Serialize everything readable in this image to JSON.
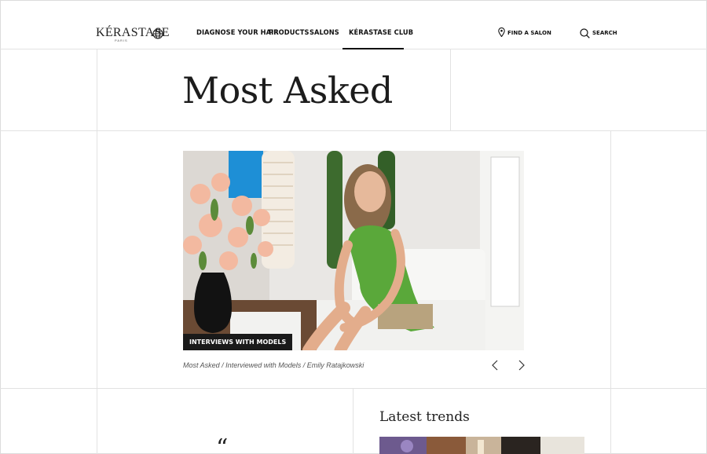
{
  "brand": {
    "logo": "KÉRASTASE",
    "logo_sub": "PARIS"
  },
  "nav": {
    "items": [
      {
        "label": "DIAGNOSE YOUR HAIR"
      },
      {
        "label": "PRODUCTS"
      },
      {
        "label": "SALONS"
      },
      {
        "label": "KÉRASTASE CLUB"
      }
    ],
    "find_salon": "FIND A SALON",
    "search": "SEARCH"
  },
  "page": {
    "title": "Most Asked"
  },
  "hero": {
    "tag": "INTERVIEWS WITH MODELS",
    "caption": "Most Asked / Interviewed with Models / Emily Ratajkowski"
  },
  "section": {
    "latest_title": "Latest trends",
    "quote_mark": "“"
  },
  "colors": {
    "text": "#1a1a1a",
    "grid": "#e2e2e2",
    "tag_bg": "#1a1a1a",
    "dress": "#5aa83a"
  }
}
